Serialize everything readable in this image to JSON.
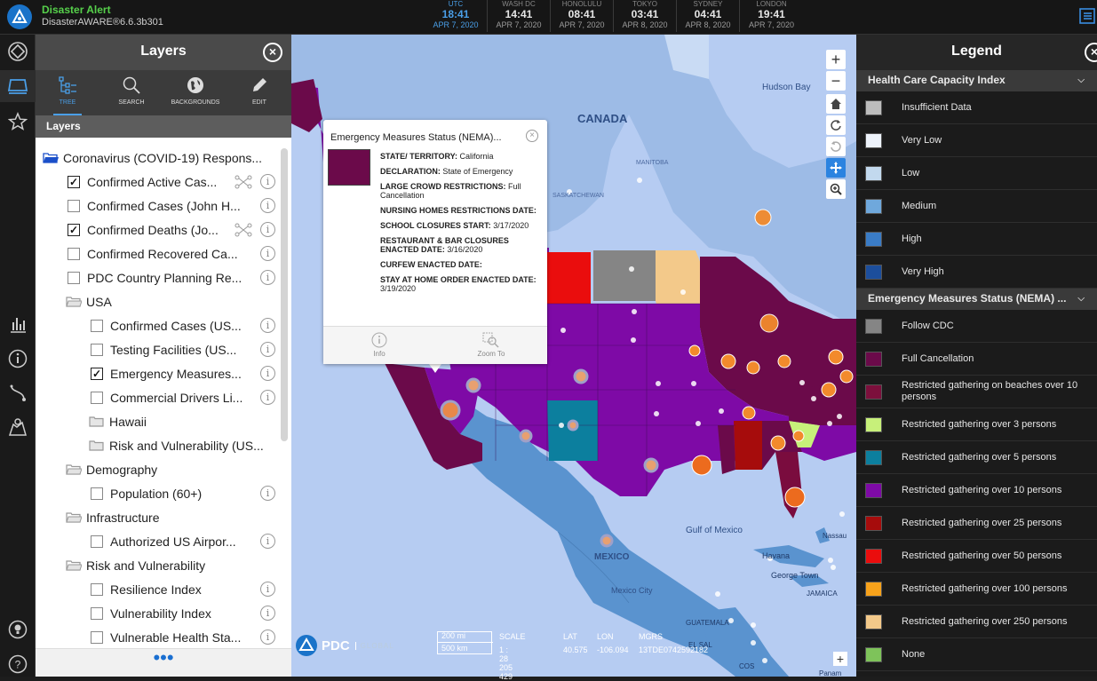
{
  "app": {
    "title": "Disaster Alert",
    "version": "DisasterAWARE®6.6.3b301"
  },
  "clocks": [
    {
      "tz": "UTC",
      "time": "18:41",
      "date": "APR 7, 2020"
    },
    {
      "tz": "WASH DC",
      "time": "14:41",
      "date": "APR 7, 2020"
    },
    {
      "tz": "HONOLULU",
      "time": "08:41",
      "date": "APR 7, 2020"
    },
    {
      "tz": "TOKYO",
      "time": "03:41",
      "date": "APR 8, 2020"
    },
    {
      "tz": "SYDNEY",
      "time": "04:41",
      "date": "APR 8, 2020"
    },
    {
      "tz": "LONDON",
      "time": "19:41",
      "date": "APR 7, 2020"
    }
  ],
  "layers": {
    "title": "Layers",
    "tabs": [
      "TREE",
      "SEARCH",
      "BACKGROUNDS",
      "EDIT"
    ],
    "subhead": "Layers",
    "items": [
      {
        "label": "Coronavirus (COVID-19) Respons...",
        "kind": "folder-open-blue",
        "checked": false
      },
      {
        "label": "Confirmed Active Cas...",
        "kind": "check",
        "checked": true
      },
      {
        "label": "Confirmed Cases (John H...",
        "kind": "check",
        "checked": false
      },
      {
        "label": "Confirmed Deaths (Jo...",
        "kind": "check",
        "checked": true
      },
      {
        "label": "Confirmed Recovered Ca...",
        "kind": "check",
        "checked": false
      },
      {
        "label": "PDC Country Planning Re...",
        "kind": "check",
        "checked": false
      },
      {
        "label": "USA",
        "kind": "folder",
        "checked": false
      },
      {
        "label": "Confirmed Cases (US...",
        "kind": "check",
        "checked": false
      },
      {
        "label": "Testing Facilities (US...",
        "kind": "check",
        "checked": false
      },
      {
        "label": "Emergency Measures...",
        "kind": "check",
        "checked": true
      },
      {
        "label": "Commercial Drivers Li...",
        "kind": "check",
        "checked": false
      },
      {
        "label": "Hawaii",
        "kind": "folder",
        "checked": false
      },
      {
        "label": "Risk and Vulnerability (US...",
        "kind": "folder",
        "checked": false
      },
      {
        "label": "Demography",
        "kind": "folder",
        "checked": false
      },
      {
        "label": "Population (60+)",
        "kind": "check",
        "checked": false
      },
      {
        "label": "Infrastructure",
        "kind": "folder",
        "checked": false
      },
      {
        "label": "Authorized US Airpor...",
        "kind": "check",
        "checked": false
      },
      {
        "label": "Risk and Vulnerability",
        "kind": "folder",
        "checked": false
      },
      {
        "label": "Resilience Index",
        "kind": "check",
        "checked": false
      },
      {
        "label": "Vulnerability Index",
        "kind": "check",
        "checked": false
      },
      {
        "label": "Vulnerable Health Sta...",
        "kind": "check",
        "checked": false
      }
    ],
    "more_label": "•••"
  },
  "map": {
    "labels": {
      "canada": "CANADA",
      "hudson_bay": "Hudson Bay",
      "manitoba": "MANITOBA",
      "saskatchewan": "SASKATCHEWAN",
      "gulf": "Gulf of Mexico",
      "mexico": "MEXICO",
      "mexico_city": "Mexico City",
      "havana": "Havana",
      "nassau": "Nassau",
      "george_town": "George Town",
      "jamaica": "JAMAICA",
      "guatemala": "GUATEMALA",
      "el_salvador": "EL SAL",
      "panama": "Panam",
      "costa": "COS"
    },
    "footer": {
      "brand": "PDC",
      "brand_sub": "GLOBAL",
      "scale_mi": "200 mi",
      "scale_km": "500 km",
      "scale_label": "SCALE",
      "scale_value": "1 : 28 205 429",
      "lat_label": "LAT",
      "lat_value": "40.575",
      "lon_label": "LON",
      "lon_value": "-106.094",
      "mgrs_label": "MGRS",
      "mgrs_value": "13TDE0742592182"
    }
  },
  "popup": {
    "title": "Emergency Measures Status (NEMA)...",
    "swatch_color": "#6b0a4a",
    "fields": [
      {
        "k": "STATE/ TERRITORY:",
        "v": "California"
      },
      {
        "k": "DECLARATION:",
        "v": "State of Emergency"
      },
      {
        "k": "LARGE CROWD RESTRICTIONS:",
        "v": "Full Cancellation"
      },
      {
        "k": "NURSING HOMES RESTRICTIONS DATE:",
        "v": ""
      },
      {
        "k": "SCHOOL CLOSURES START:",
        "v": "3/17/2020"
      },
      {
        "k": "RESTAURANT & BAR CLOSURES ENACTED DATE:",
        "v": "3/16/2020"
      },
      {
        "k": "CURFEW ENACTED DATE:",
        "v": ""
      },
      {
        "k": "STAY AT HOME ORDER ENACTED DATE:",
        "v": "3/19/2020"
      }
    ],
    "actions": [
      "Info",
      "Zoom To"
    ]
  },
  "legend": {
    "title": "Legend",
    "sections": [
      {
        "title": "Health Care Capacity Index",
        "items": [
          {
            "label": "Insufficient Data",
            "color": "#bdbdbd"
          },
          {
            "label": "Very Low",
            "color": "#eef3fb"
          },
          {
            "label": "Low",
            "color": "#c2d9ee"
          },
          {
            "label": "Medium",
            "color": "#6fa8dc"
          },
          {
            "label": "High",
            "color": "#3a7cc6"
          },
          {
            "label": "Very High",
            "color": "#1c4e9c"
          }
        ]
      },
      {
        "title": "Emergency Measures Status (NEMA) ...",
        "items": [
          {
            "label": "Follow CDC",
            "color": "#858585"
          },
          {
            "label": "Full Cancellation",
            "color": "#6b0a4a"
          },
          {
            "label": "Restricted gathering on beaches over 10 persons",
            "color": "#7c0f3c"
          },
          {
            "label": "Restricted gathering over 3 persons",
            "color": "#c7f07a"
          },
          {
            "label": "Restricted gathering over 5 persons",
            "color": "#0c7f9e"
          },
          {
            "label": "Restricted gathering over 10 persons",
            "color": "#7e0aa6"
          },
          {
            "label": "Restricted gathering over 25 persons",
            "color": "#a60c0c"
          },
          {
            "label": "Restricted gathering over 50 persons",
            "color": "#ea0d0d"
          },
          {
            "label": "Restricted gathering over 100 persons",
            "color": "#f7a21b"
          },
          {
            "label": "Restricted gathering over 250 persons",
            "color": "#f3c98a"
          },
          {
            "label": "None",
            "color": "#7ec35a"
          }
        ]
      }
    ]
  }
}
